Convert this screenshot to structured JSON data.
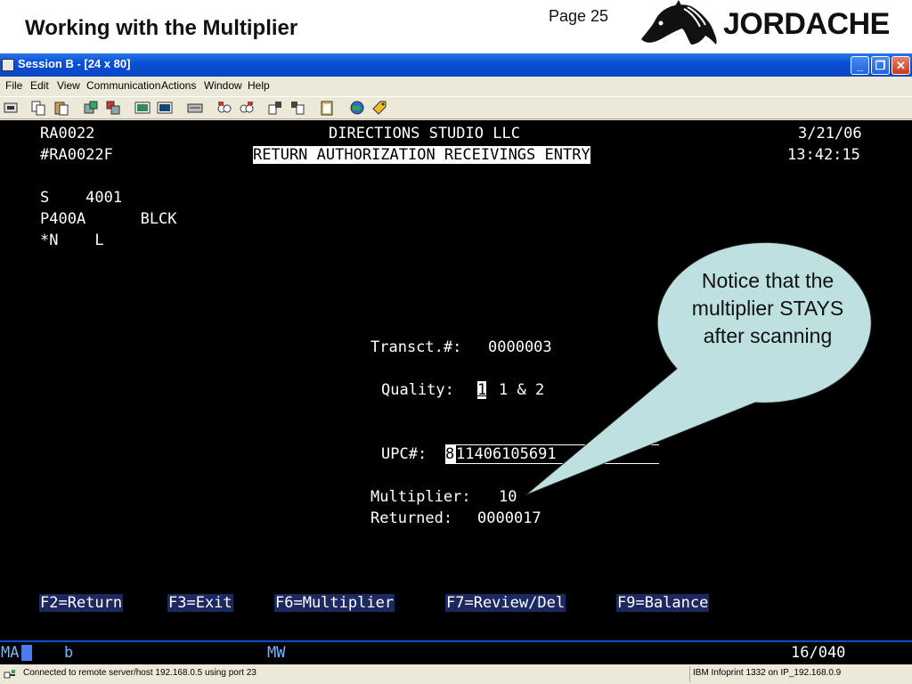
{
  "slide": {
    "title": "Working with the Multiplier",
    "page_label": "Page 25",
    "logo_text": "JORDACHE"
  },
  "window": {
    "title": "Session B - [24 x 80]",
    "minimize_glyph": "_",
    "maximize_glyph": "❐",
    "close_glyph": "✕"
  },
  "menu": [
    "File",
    "Edit",
    "View",
    "Communication",
    "Actions",
    "Window",
    "Help"
  ],
  "terminal": {
    "program": "RA0022",
    "company": "DIRECTIONS STUDIO LLC",
    "date": "3/21/06",
    "format": "#RA0022F",
    "screen_title": "RETURN AUTHORIZATION RECEIVINGS ENTRY",
    "time": "13:42:15",
    "line_s": "S    4001",
    "line_p": "P400A      BLCK",
    "line_n": "*N    L",
    "transact_label": "Transct.#:",
    "transact_value": "0000003",
    "quality_label": "Quality:",
    "quality_value": "1",
    "quality_options": "1 & 2",
    "upc_label": "UPC#:",
    "upc_first": "8",
    "upc_rest": "11406105691",
    "multiplier_label": "Multiplier:",
    "multiplier_value": "10",
    "returned_label": "Returned:",
    "returned_value": "0000017",
    "fkeys": [
      "F2=Return",
      "F3=Exit",
      "F6=Multiplier",
      "F7=Review/Del",
      "F9=Balance"
    ]
  },
  "oia": {
    "ma": "MA",
    "b": "b",
    "mw": "MW",
    "cursor_pos": "16/040"
  },
  "statusbar": {
    "connection": "Connected to remote server/host 192.168.0.5 using port 23",
    "printer": "IBM Infoprint 1332 on IP_192.168.0.9"
  },
  "callout": {
    "text": "Notice that the multiplier STAYS after scanning",
    "fill": "#bfe0e0"
  }
}
